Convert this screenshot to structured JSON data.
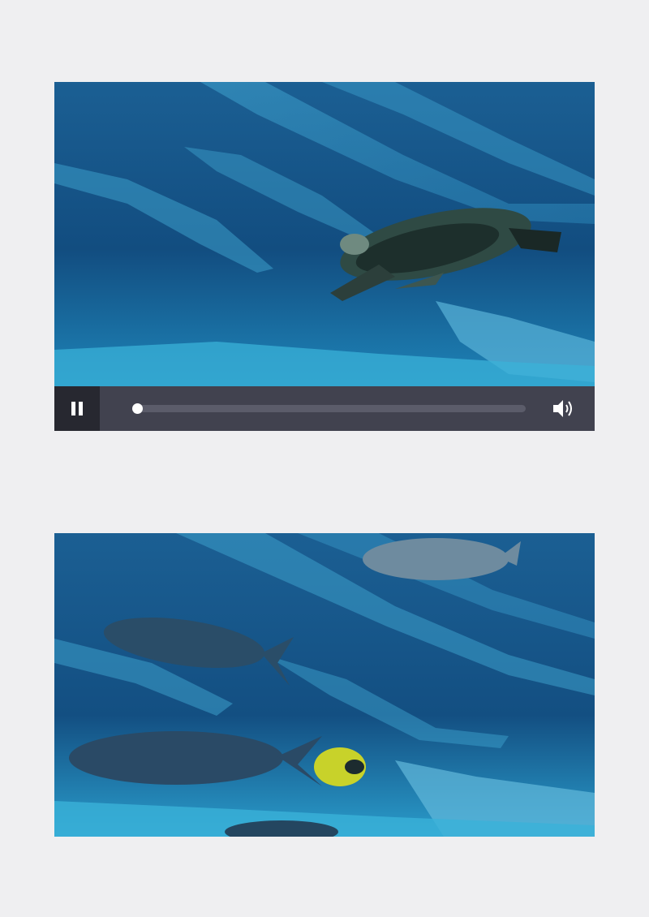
{
  "player": {
    "progress_fraction": 0.0,
    "state": "playing",
    "pause_icon": "pause-icon",
    "volume_icon": "volume-icon"
  },
  "colors": {
    "page_background": "#efeff1",
    "control_bar": "#41424f",
    "pause_button_bg": "#272830",
    "progress_track": "#5b5c6a",
    "icon": "#ffffff",
    "water_deep": "#0c3f6e",
    "water_light": "#2a93c4"
  },
  "frames": [
    {
      "subject": "sea-turtle",
      "icon": "turtle-icon"
    },
    {
      "subject": "fish",
      "icon": "fish-icon"
    }
  ]
}
